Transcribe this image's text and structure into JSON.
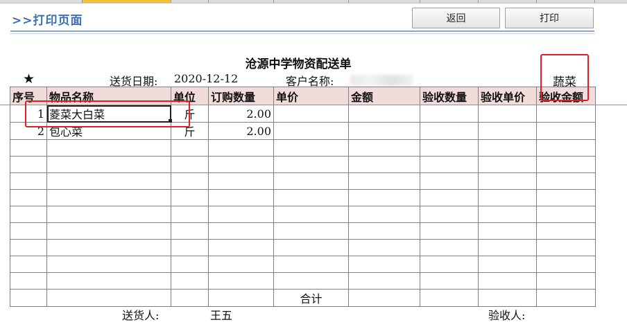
{
  "header": {
    "page_title": ">>打印页面",
    "back_label": "返回",
    "print_label": "打印"
  },
  "document": {
    "title": "沧源中学物资配送单",
    "star": "★",
    "date_label": "送货日期:",
    "date_value": "2020-12-12",
    "customer_label": "客户名称:",
    "category": "蔬菜"
  },
  "table": {
    "columns": [
      "序号",
      "物品名称",
      "单位",
      "订购数量",
      "单价",
      "金额",
      "验收数量",
      "验收单价",
      "验收金额"
    ],
    "rows": [
      {
        "no": "1",
        "name": "菱菜大白菜",
        "unit": "斤",
        "qty": "2.00"
      },
      {
        "no": "2",
        "name": "包心菜",
        "unit": "斤",
        "qty": "2.00"
      }
    ],
    "total_label": "合计"
  },
  "footer": {
    "deliverer_label": "送货人:",
    "deliverer_value": "王五",
    "receiver_label": "验收人:"
  },
  "colors": {
    "header_fill": "#f2dcdb",
    "title_blue": "#3a6fb0",
    "highlight_red": "#e02020"
  }
}
